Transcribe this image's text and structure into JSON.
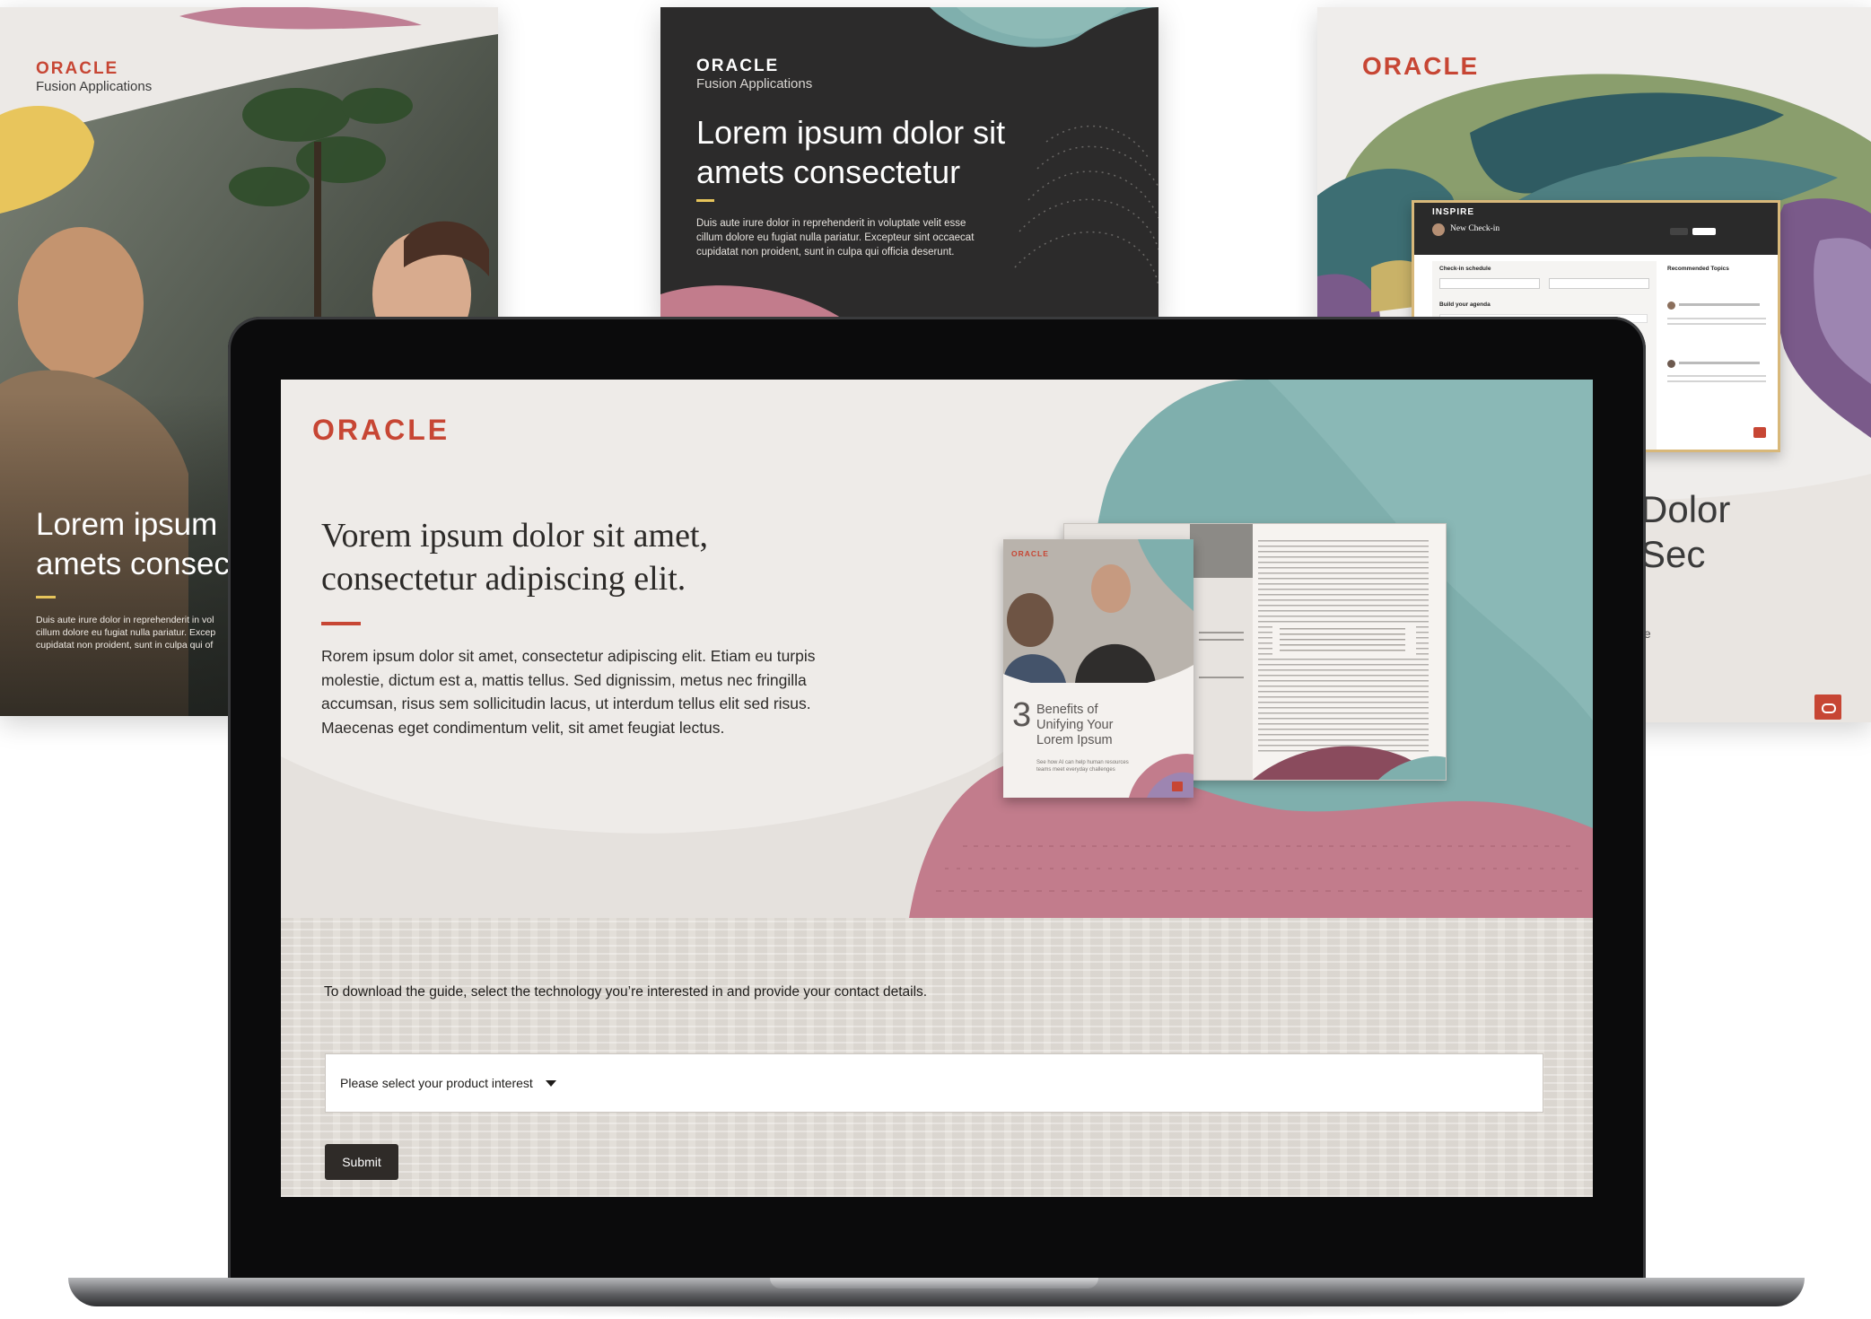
{
  "card_left": {
    "logo": "ORACLE",
    "subtitle": "Fusion Applications",
    "headline_lines": [
      "Lorem ipsum",
      "amets consec"
    ],
    "body_lines": [
      "Duis aute irure dolor in reprehenderit in vol",
      "cillum dolore eu fugiat nulla pariatur. Excep",
      "cupidatat non proident, sunt in culpa qui of"
    ]
  },
  "card_mid": {
    "logo": "ORACLE",
    "subtitle": "Fusion Applications",
    "headline_lines": [
      "Lorem ipsum dolor sit",
      "amets consectetur"
    ],
    "body_lines": [
      "Duis aute irure dolor in reprehenderit in voluptate velit esse",
      "cillum dolore eu fugiat nulla pariatur. Excepteur sint occaecat",
      "cupidatat non proident, sunt in culpa qui officia deserunt."
    ]
  },
  "card_right": {
    "logo": "ORACLE",
    "headline_lines": [
      "Dolor",
      "Sec"
    ],
    "fragment": "te",
    "app_window": {
      "brand": "INSPIRE",
      "title": "New Check-in",
      "section_schedule": "Check-in schedule",
      "section_agenda": "Build your agenda",
      "panel_title": "Recommended Topics"
    }
  },
  "screen": {
    "logo": "ORACLE",
    "headline": "Vorem ipsum dolor sit amet, consectetur adipiscing elit.",
    "body": "Rorem ipsum dolor sit amet, consectetur adipiscing elit. Etiam eu turpis molestie, dictum est a, mattis tellus. Sed dignissim, metus nec fringilla accumsan, risus sem sollicitudin lacus, ut interdum tellus elit sed risus. Maecenas eget condimentum velit, sit amet feugiat lectus.",
    "booklet": {
      "logo": "ORACLE",
      "number": "3",
      "title_lines": [
        "Benefits of",
        "Unifying Your",
        "Lorem Ipsum"
      ],
      "tagline_lines": [
        "See how AI can help human resources",
        "teams meet everyday challenges"
      ]
    },
    "instructions": "To download the guide, select the technology you’re interested in and provide your contact details.",
    "select_placeholder": "Please select your product interest",
    "submit_label": "Submit"
  },
  "colors": {
    "oracle_red": "#c74634",
    "teal": "#7fafad",
    "rose": "#c27c8c",
    "yellow": "#e6c45b",
    "dark": "#2c2b2b",
    "submit": "#2f2b28"
  }
}
